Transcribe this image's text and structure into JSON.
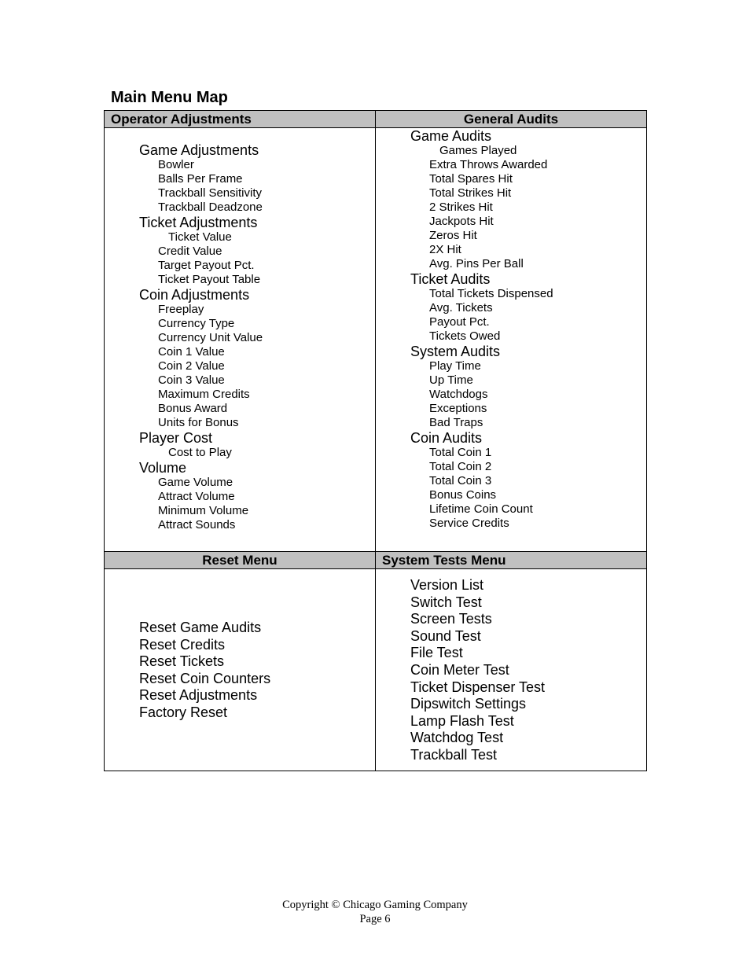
{
  "title": "Main Menu Map",
  "operator_adjustments": {
    "header": "Operator Adjustments",
    "sections": [
      {
        "label": "Game Adjustments",
        "items": [
          "Bowler",
          "Balls Per Frame",
          "Trackball Sensitivity",
          "Trackball Deadzone"
        ]
      },
      {
        "label": "Ticket Adjustments",
        "items": [
          "Ticket Value",
          "Credit Value",
          "Target Payout Pct.",
          "Ticket Payout Table"
        ]
      },
      {
        "label": "Coin Adjustments",
        "items": [
          "Freeplay",
          "Currency Type",
          "Currency Unit Value",
          "Coin 1 Value",
          "Coin 2 Value",
          "Coin 3 Value",
          "Maximum Credits",
          "Bonus Award",
          "Units for Bonus"
        ]
      },
      {
        "label": "Player Cost",
        "items": [
          "Cost to Play"
        ]
      },
      {
        "label": "Volume",
        "items": [
          "Game Volume",
          "Attract Volume",
          "Minimum Volume",
          "Attract Sounds"
        ]
      }
    ]
  },
  "general_audits": {
    "header": "General Audits",
    "sections": [
      {
        "label": "Game Audits",
        "items": [
          "Games Played",
          "Extra Throws Awarded",
          "Total Spares Hit",
          "Total Strikes Hit",
          "2 Strikes Hit",
          "Jackpots Hit",
          "Zeros Hit",
          "2X Hit",
          "Avg. Pins Per Ball"
        ]
      },
      {
        "label": "Ticket Audits",
        "items": [
          "Total Tickets Dispensed",
          "Avg. Tickets",
          "Payout Pct.",
          "Tickets Owed"
        ]
      },
      {
        "label": "System Audits",
        "items": [
          "Play Time",
          "Up Time",
          "Watchdogs",
          "Exceptions",
          "Bad Traps"
        ]
      },
      {
        "label": "Coin Audits",
        "items": [
          "Total Coin 1",
          "Total Coin 2",
          "Total Coin 3",
          "Bonus Coins",
          "Lifetime Coin Count",
          "Service Credits"
        ]
      }
    ]
  },
  "reset_menu": {
    "header": "Reset Menu",
    "items": [
      "Reset Game Audits",
      "Reset Credits",
      "Reset Tickets",
      "Reset Coin Counters",
      "Reset Adjustments",
      "Factory Reset"
    ]
  },
  "system_tests_menu": {
    "header": "System Tests Menu",
    "items": [
      "Version List",
      "Switch Test",
      "Screen Tests",
      "Sound Test",
      "File Test",
      "Coin Meter Test",
      "Ticket Dispenser Test",
      "Dipswitch Settings",
      "Lamp Flash Test",
      "Watchdog Test",
      "Trackball Test"
    ]
  },
  "footer": {
    "copyright": "Copyright © Chicago Gaming Company",
    "page": "Page 6"
  }
}
